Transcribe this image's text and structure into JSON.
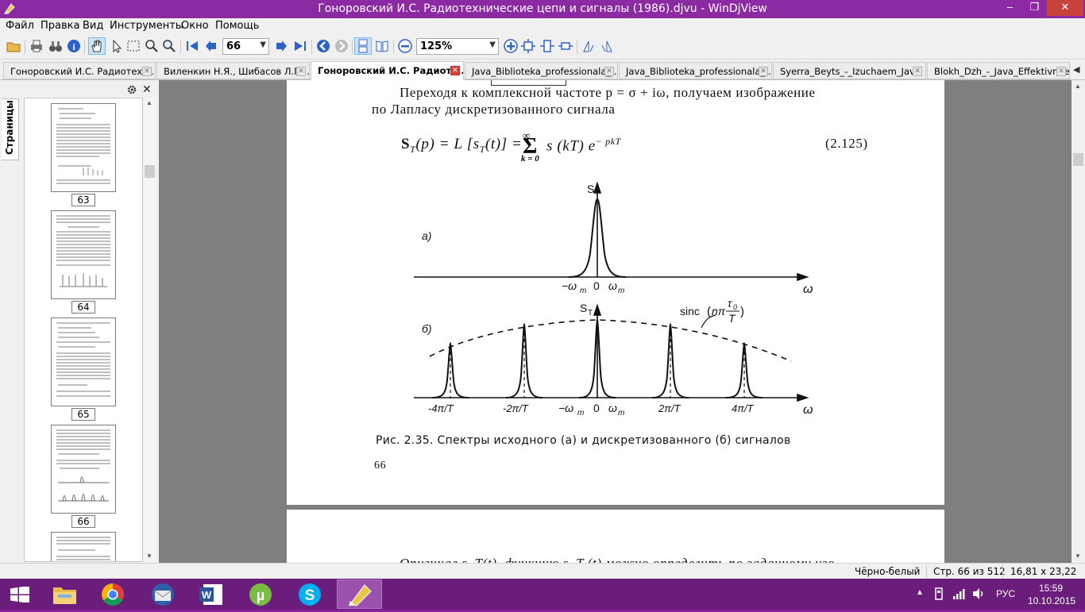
{
  "window": {
    "title": "Гоноровский И.С. Радиотехнические цепи и сигналы (1986).djvu - WinDjView",
    "minimize": "‒",
    "maximize": "❐",
    "close": "✕"
  },
  "menu": [
    "Файл",
    "Правка",
    "Вид",
    "Инструменты",
    "Окно",
    "Помощь"
  ],
  "toolbar": {
    "page_value": "66",
    "zoom_value": "125%"
  },
  "tabs": [
    {
      "label": "Гоноровский И.С. Радиотехн...",
      "active": false
    },
    {
      "label": "Виленкин Н.Я., Шибасов Л.П....",
      "active": false
    },
    {
      "label": "Гоноровский И.С. Радиоте...",
      "active": true
    },
    {
      "label": "Java_Biblioteka_professionala_...",
      "active": false
    },
    {
      "label": "Java_Biblioteka_professionala_...",
      "active": false
    },
    {
      "label": "Syerra_Beyts_-_Izuchaem_Jav...",
      "active": false
    },
    {
      "label": "Blokh_Dzh_-_Java_Effektivnoe...",
      "active": false
    }
  ],
  "sidebar": {
    "tab_label": "Страницы",
    "thumbnails": [
      "63",
      "64",
      "65",
      "66",
      ""
    ]
  },
  "document": {
    "line1": "Переходя  к  комплексной  частоте  p = σ +  iω,  получаем  изображение",
    "line2": "по  Лапласу  дискретизованного  сигнала",
    "formula_lhs": "S",
    "formula_sub": "T",
    "formula_body": "(p) = L [s",
    "formula_rest": "(t)] =",
    "formula_sum_top": "∞",
    "formula_sum_bot": "k = 0",
    "formula_term": "s (kT) e",
    "formula_exp": "− pkT",
    "formula_num": "(2.125)",
    "fig_a_label": "а)",
    "fig_b_label": "б)",
    "axis_s": "S",
    "axis_st": "S",
    "axis_st_sub": "T",
    "omega": "ω",
    "ticks_a": [
      "−ω",
      "0",
      "ω"
    ],
    "tick_sub": "m",
    "ticks_b": [
      "-4π/T",
      "-2π/T",
      "−ω",
      "0",
      "ω",
      "2π/T",
      "4π/T"
    ],
    "sinc_label": "sinc",
    "sinc_arg": "nπ",
    "sinc_num": "τ",
    "sinc_num_sub": "0",
    "sinc_den": "T",
    "caption": "Рис. 2.35. Спектры исходного  (а)  и  дискретизованного  (б)  сигналов",
    "page_number": "66",
    "next_line": "Оригинал  s_T(t),  функцию  s_T (t)  можно определить по заданному  изо-"
  },
  "status": {
    "mode": "Чёрно-белый",
    "page": "Стр. 66 из 512",
    "size": "16,81 x 23,22 см"
  },
  "tray": {
    "lang": "РУС",
    "time": "15:59",
    "date": "10.10.2015"
  }
}
